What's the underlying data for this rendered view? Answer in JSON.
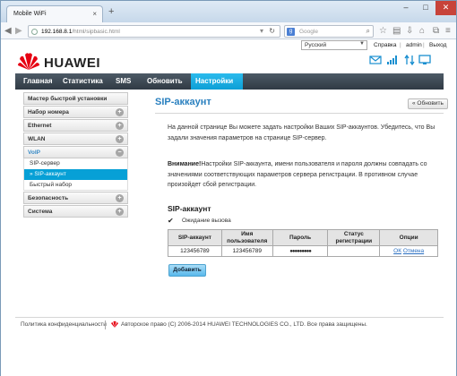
{
  "browser": {
    "tab_title": "Mobile WiFi",
    "new_tab": "+",
    "url_host": "192.168.8.1",
    "url_path": "/html/sipbasic.html",
    "search_engine": "Google",
    "search_placeholder": "Google",
    "controls": {
      "minimize": "–",
      "maximize": "□",
      "close": "✕"
    }
  },
  "header": {
    "language": "Русский",
    "help": "Справка",
    "user": "admin",
    "logout": "Выход",
    "brand": "HUAWEI"
  },
  "menu": [
    {
      "label": "Главная"
    },
    {
      "label": "Статистика"
    },
    {
      "label": "SMS"
    },
    {
      "label": "Обновить"
    },
    {
      "label": "Настройки"
    }
  ],
  "sidebar": {
    "items": [
      {
        "label": "Мастер быстрой установки"
      },
      {
        "label": "Набор номера"
      },
      {
        "label": "Ethernet"
      },
      {
        "label": "WLAN"
      },
      {
        "label": "VoIP"
      }
    ],
    "voip_sub": [
      {
        "label": "SIP-сервер"
      },
      {
        "label": "» SIP-аккаунт"
      },
      {
        "label": "Быстрый набор"
      }
    ],
    "bottom": [
      {
        "label": "Безопасность"
      },
      {
        "label": "Система"
      }
    ]
  },
  "content": {
    "title": "SIP-аккаунт",
    "refresh_label": "Обновить",
    "intro": "На данной странице Вы можете задать настройки Ваших SIP-аккаунтов. Убедитесь, что Вы задали значения параметров на странице SIP-сервер.",
    "warning_bold": "Внимание!",
    "warning": "Настройки SIP-аккаунта, имени пользователя и пароля должны совпадать со значениями соответствующих параметров сервера регистрации. В противном случае произойдет сбой регистрации.",
    "section_title": "SIP-аккаунт",
    "call_waiting_label": "Ожидание вызова",
    "call_waiting_checked": true,
    "table": {
      "headers": [
        "SIP-аккаунт",
        "Имя пользователя",
        "Пароль",
        "Статус регистрации",
        "Опции"
      ],
      "rows": [
        {
          "account": "123456789",
          "username": "123456789",
          "password": "●●●●●●●●●",
          "status": "",
          "edit": "ОК",
          "cancel": "Отмена"
        }
      ]
    },
    "add_label": "Добавить"
  },
  "footer": {
    "privacy": "Политика конфиденциальности",
    "copyright": "Авторское право (C) 2006-2014 HUAWEI TECHNOLOGIES CO., LTD. Все права защищены."
  },
  "colors": {
    "brand_red": "#e60012",
    "accent": "#0ea1d8",
    "menubar": "#3a4550"
  }
}
